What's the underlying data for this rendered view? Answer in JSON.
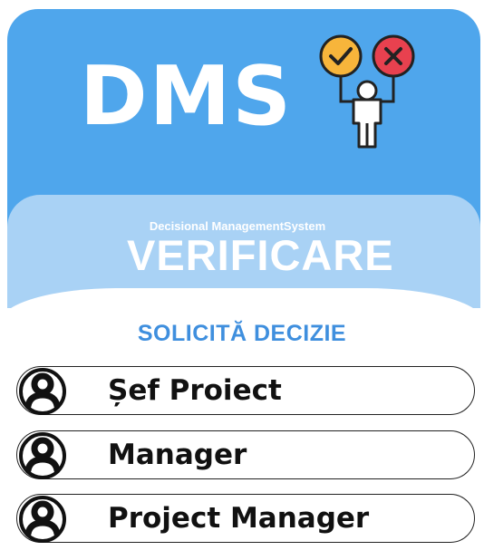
{
  "app": {
    "logo_text": "DMS",
    "subtitle": "Decisional ManagementSystem",
    "mode_title": "VERIFICARE",
    "logo_icon": "person-holding-check-and-x-icon"
  },
  "section": {
    "title": "SOLICITĂ DECIZIE"
  },
  "roles": [
    {
      "label": "Șef Proiect",
      "icon": "user-icon"
    },
    {
      "label": "Manager",
      "icon": "user-icon"
    },
    {
      "label": "Project Manager",
      "icon": "user-icon"
    }
  ],
  "colors": {
    "header": "#4fa6ec",
    "band": "#a9d2f5",
    "accent": "#3f8fde",
    "check": "#f7b53b",
    "cross": "#e8414f"
  }
}
